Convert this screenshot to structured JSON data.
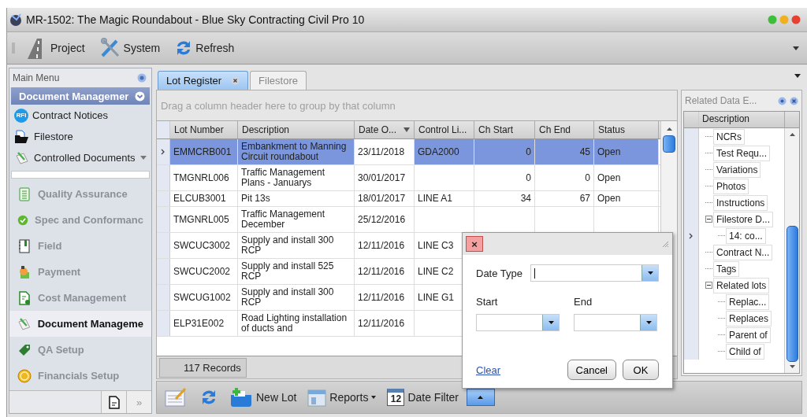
{
  "window": {
    "title": "MR-1502: The Magic Roundabout - Blue Sky Contracting Civil Pro 10"
  },
  "toolbar": [
    {
      "label": "Project"
    },
    {
      "label": "System"
    },
    {
      "label": "Refresh"
    }
  ],
  "main_menu": {
    "title": "Main Menu",
    "group": {
      "title": "Document Managemer",
      "expanded": true,
      "items": [
        {
          "label": "Contract Notices",
          "icon_text": "RFI",
          "has_menu": false
        },
        {
          "label": "Filestore",
          "has_menu": false
        },
        {
          "label": "Controlled Documents",
          "has_menu": true
        }
      ]
    },
    "nav": [
      {
        "label": "Quality Assurance",
        "selected": false
      },
      {
        "label": "Spec and Conformanc",
        "selected": false
      },
      {
        "label": "Field",
        "selected": false
      },
      {
        "label": "Payment",
        "selected": false
      },
      {
        "label": "Cost Management",
        "selected": false
      },
      {
        "label": "Document Manageme",
        "selected": true
      },
      {
        "label": "QA Setup",
        "selected": false
      },
      {
        "label": "Financials Setup",
        "selected": false
      }
    ],
    "more_button": "»"
  },
  "tabs": [
    {
      "label": "Lot Register",
      "selected": true,
      "closable": true
    },
    {
      "label": "Filestore",
      "selected": false,
      "closable": false
    }
  ],
  "grid": {
    "group_hint": "Drag a column header here to group by that column",
    "columns": [
      {
        "label": "Lot Number",
        "kind": "text",
        "sorted": false,
        "focused": false
      },
      {
        "label": "Description",
        "kind": "text",
        "sorted": false,
        "focused": false
      },
      {
        "label": "Date O...",
        "kind": "text",
        "sorted": true,
        "focused": true
      },
      {
        "label": "Control Li...",
        "kind": "text",
        "sorted": false,
        "focused": false
      },
      {
        "label": "Ch Start",
        "kind": "number",
        "sorted": false,
        "focused": false
      },
      {
        "label": "Ch End",
        "kind": "number",
        "sorted": false,
        "focused": false
      },
      {
        "label": "Status",
        "kind": "text",
        "sorted": false,
        "focused": false
      }
    ],
    "rows": [
      {
        "selected": true,
        "cells": [
          "EMMCRB001",
          "Embankment to Manning Circuit roundabout",
          "23/11/2018",
          "GDA2000",
          "0",
          "45",
          "Open"
        ]
      },
      {
        "selected": false,
        "cells": [
          "TMGNRL006",
          "Traffic Management Plans - Januarys",
          "30/01/2017",
          null,
          "0",
          "0",
          "Open"
        ]
      },
      {
        "selected": false,
        "cells": [
          "ELCUB3001",
          "Pit 13s",
          "18/01/2017",
          "LINE A1",
          "34",
          "67",
          "Open"
        ]
      },
      {
        "selected": false,
        "cells": [
          "TMGNRL005",
          "Traffic Management December",
          "25/12/2016",
          null,
          null,
          null,
          null
        ]
      },
      {
        "selected": false,
        "cells": [
          "SWCUC3002",
          "Supply and install 300 RCP",
          "12/11/2016",
          "LINE C3",
          null,
          null,
          null
        ]
      },
      {
        "selected": false,
        "cells": [
          "SWCUC2002",
          "Supply and install 525 RCP",
          "12/11/2016",
          "LINE C2",
          null,
          null,
          null
        ]
      },
      {
        "selected": false,
        "cells": [
          "SWCUG1002",
          "Supply and install 300 RCP",
          "12/11/2016",
          "LINE G1",
          null,
          null,
          null
        ]
      },
      {
        "selected": false,
        "cells": [
          "ELP31E002",
          "Road Lighting installation of ducts and",
          "12/11/2016",
          null,
          null,
          null,
          null
        ]
      }
    ],
    "record_count": "117 Records"
  },
  "related": {
    "title": "Related Data E...",
    "column": "Description",
    "items": [
      {
        "label": "NCRs",
        "current": false
      },
      {
        "label": "Test Requ...",
        "current": false
      },
      {
        "label": "Variations",
        "current": false
      },
      {
        "label": "Photos",
        "current": false
      },
      {
        "label": "Instructions",
        "current": false
      },
      {
        "label": "Filestore D...",
        "current": false,
        "expanded": true,
        "children": [
          {
            "label": "14: co...",
            "current": true
          }
        ]
      },
      {
        "label": "Contract N...",
        "current": false
      },
      {
        "label": "Tags",
        "current": false
      },
      {
        "label": "Related lots",
        "current": false,
        "expanded": true,
        "children": [
          {
            "label": "Replac...",
            "current": false
          },
          {
            "label": "Replaces",
            "current": false
          },
          {
            "label": "Parent of",
            "current": false
          },
          {
            "label": "Child of",
            "current": false
          }
        ]
      }
    ]
  },
  "bottom_toolbar": [
    {
      "kind": "icon"
    },
    {
      "kind": "icon"
    },
    {
      "kind": "button",
      "label": "New Lot"
    },
    {
      "kind": "menu",
      "label": "Reports"
    },
    {
      "kind": "button",
      "label": "Date Filter",
      "icon_text": "12"
    },
    {
      "kind": "toggle",
      "expanded": true
    }
  ],
  "dialog": {
    "close": "×",
    "date_type": {
      "label": "Date Type",
      "focused": true
    },
    "start": {
      "label": "Start"
    },
    "end": {
      "label": "End"
    },
    "clear_link": "Clear",
    "buttons": [
      "Cancel",
      "OK"
    ]
  }
}
